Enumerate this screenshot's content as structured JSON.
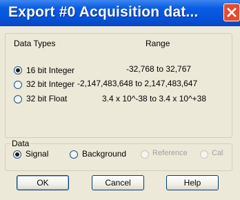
{
  "window": {
    "title": "Export #0  Acquisition dat...",
    "close_glyph": "X"
  },
  "data_types": {
    "legend": "Data Types",
    "range_header": "Range",
    "options": [
      {
        "label": "16 bit Integer",
        "range": "-32,768  to  32,767",
        "checked": true
      },
      {
        "label": "32 bit Integer",
        "range": "-2,147,483,648  to 2,147,483,647",
        "checked": false
      },
      {
        "label": "32 bit Float",
        "range": "3.4 x 10^-38  to  3.4 x 10^+38",
        "checked": false
      }
    ]
  },
  "data": {
    "legend": "Data",
    "options": [
      {
        "label": "Signal",
        "checked": true,
        "enabled": true
      },
      {
        "label": "Background",
        "checked": false,
        "enabled": true
      },
      {
        "label": "Reference",
        "checked": false,
        "enabled": false
      },
      {
        "label": "Cal",
        "checked": false,
        "enabled": false
      }
    ]
  },
  "buttons": {
    "ok": "OK",
    "cancel": "Cancel",
    "help": "Help"
  }
}
